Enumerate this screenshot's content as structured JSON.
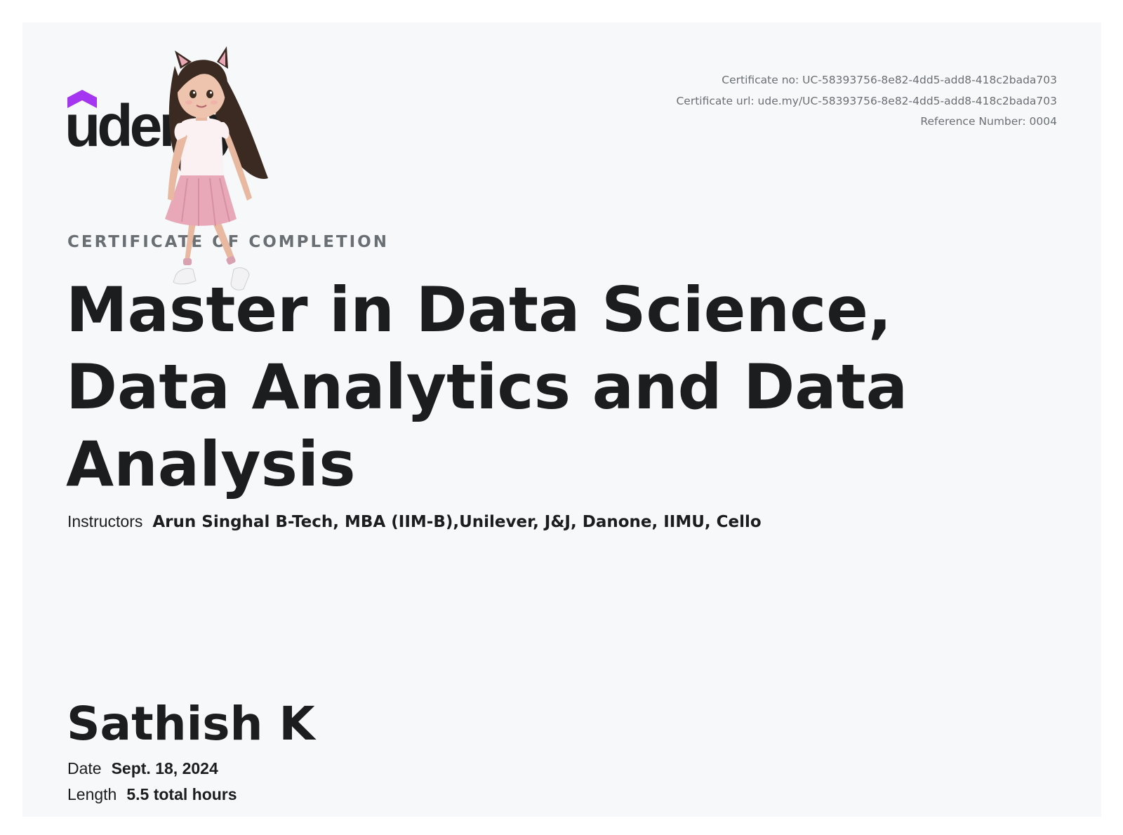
{
  "brand": {
    "logo_text": "udemy",
    "accent_color": "#a435f0"
  },
  "meta": {
    "certificate_no": "Certificate no: UC-58393756-8e82-4dd5-add8-418c2bada703",
    "certificate_url": "Certificate url: ude.my/UC-58393756-8e82-4dd5-add8-418c2bada703",
    "reference_number": "Reference Number: 0004"
  },
  "certificate": {
    "label": "CERTIFICATE OF COMPLETION",
    "course_title": "Master in Data Science, Data Analytics and Data Analysis",
    "instructors_label": "Instructors",
    "instructors_value": "Arun Singhal B-Tech, MBA (IIM-B),Unilever, J&J, Danone, IIMU, Cello",
    "recipient_name": "Sathish K",
    "date_label": "Date",
    "date_value": "Sept. 18, 2024",
    "length_label": "Length",
    "length_value": "5.5 total hours"
  }
}
